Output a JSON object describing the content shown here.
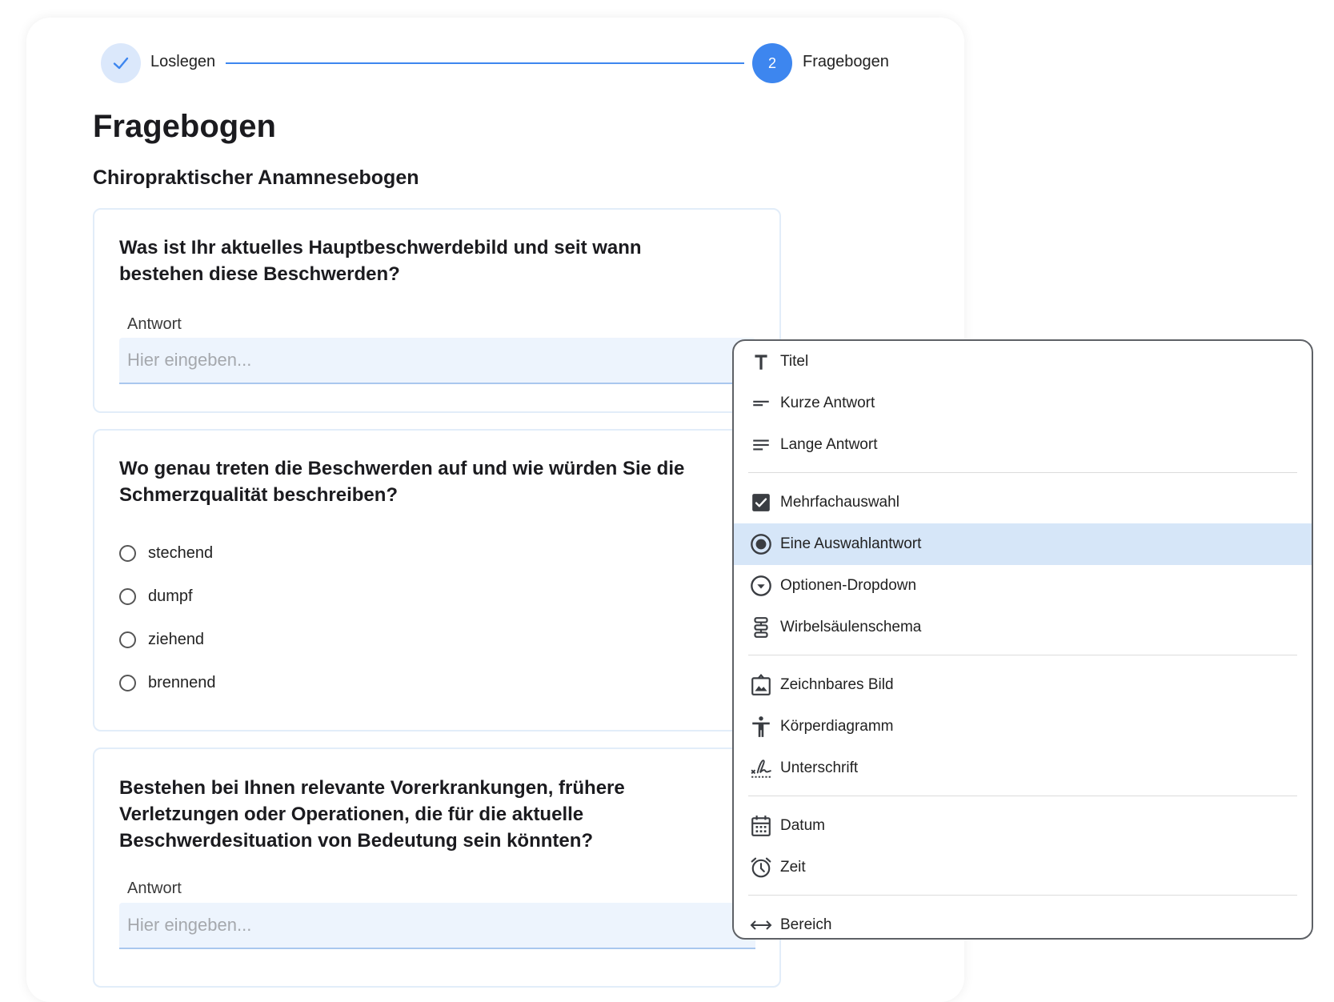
{
  "stepper": {
    "step1": {
      "label": "Loslegen",
      "state": "done"
    },
    "step2": {
      "number": "2",
      "label": "Fragebogen",
      "state": "active"
    }
  },
  "page": {
    "title": "Fragebogen",
    "form_title": "Chiropraktischer Anamnesebogen"
  },
  "questions": [
    {
      "text": "Was ist Ihr aktuelles Hauptbeschwerdebild und seit wann bestehen diese Beschwerden?",
      "answer_label": "Antwort",
      "placeholder": "Hier eingeben..."
    },
    {
      "text": "Wo genau treten die Beschwerden auf und wie würden Sie die Schmerzqualität beschreiben?",
      "options": [
        "stechend",
        "dumpf",
        "ziehend",
        "brennend"
      ]
    },
    {
      "text": "Bestehen bei Ihnen relevante Vorerkrankungen, frühere Verletzungen oder Operationen, die für die aktuelle Beschwerdesituation von Bedeutung sein könnten?",
      "answer_label": "Antwort",
      "placeholder": "Hier eingeben..."
    }
  ],
  "type_menu": {
    "selected": "Eine Auswahlantwort",
    "items": [
      {
        "label": "Titel",
        "icon": "title-icon"
      },
      {
        "label": "Kurze Antwort",
        "icon": "short-text-icon"
      },
      {
        "label": "Lange Antwort",
        "icon": "long-text-icon"
      },
      {
        "label": "Mehrfachauswahl",
        "icon": "checkbox-icon"
      },
      {
        "label": "Eine Auswahlantwort",
        "icon": "radio-icon"
      },
      {
        "label": "Optionen-Dropdown",
        "icon": "dropdown-icon"
      },
      {
        "label": "Wirbelsäulenschema",
        "icon": "spine-icon"
      },
      {
        "label": "Zeichnbares Bild",
        "icon": "drawable-image-icon"
      },
      {
        "label": "Körperdiagramm",
        "icon": "body-diagram-icon"
      },
      {
        "label": "Unterschrift",
        "icon": "signature-icon"
      },
      {
        "label": "Datum",
        "icon": "calendar-icon"
      },
      {
        "label": "Zeit",
        "icon": "alarm-clock-icon"
      },
      {
        "label": "Bereich",
        "icon": "range-arrows-icon"
      }
    ]
  },
  "colors": {
    "accent": "#3d86ef",
    "accent_light": "#dbe8fb",
    "selected_bg": "#d6e6f8",
    "input_bg": "#edf4fd"
  }
}
